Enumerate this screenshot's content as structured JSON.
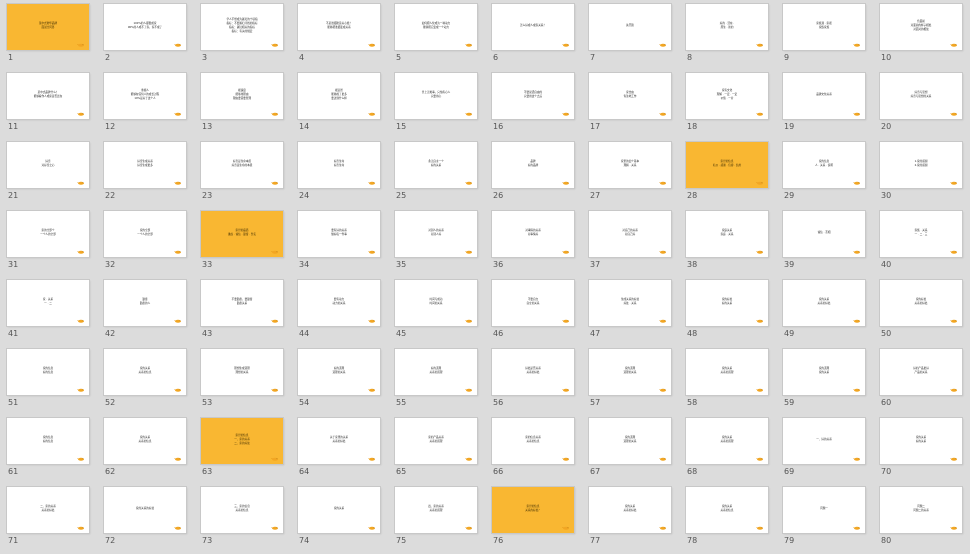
{
  "slides": [
    {
      "n": "1",
      "y": true,
      "t": "某中式奢华品牌\n面试全问答"
    },
    {
      "n": "2",
      "t": "100%的人都很成家\n90%的人成不了家，家不成了"
    },
    {
      "n": "3",
      "t": "学人不想成为寡妇的十项指\n指标：不要寡妇寻找的指标\n指标：寡妇相关的指标\n指标：有关的规定"
    },
    {
      "n": "4",
      "t": "不是谁都愿意关心谁？\n能够把谁都变成关系"
    },
    {
      "n": "5",
      "t": "如何把人化成为一种动力\n能够把它变成一个动力"
    },
    {
      "n": "6",
      "t": "怎么好成人成家关系？"
    },
    {
      "n": "7",
      "t": "先开篇"
    },
    {
      "n": "8",
      "t": "好的 · 活在 ·\n原生 · 新的"
    },
    {
      "n": "9",
      "t": "家族观 · 家观\n家族家族"
    },
    {
      "n": "10",
      "t": "色面前\n对面前的样子相处\n对面对的相处"
    },
    {
      "n": "11",
      "t": "某中式品牌什么？\n能够看作人成家是否还在"
    },
    {
      "n": "12",
      "t": "重视人\n能够在任何人的成长过程\n10%是关于这个人"
    },
    {
      "n": "13",
      "t": "视速度\n能够用理由\n理由要需要管理"
    },
    {
      "n": "14",
      "t": "视远景\n能够成了更多\n要达到什么样"
    },
    {
      "n": "15",
      "t": "世上无难事，只怕有心人\n只要用心"
    },
    {
      "n": "16",
      "t": "不要说话自由的\n只要用这个之后"
    },
    {
      "n": "17",
      "t": "家舍由\n专注地工作"
    },
    {
      "n": "18",
      "t": "家有文化\n理解 · 一定 · 一定\n价值 · 一片"
    },
    {
      "n": "19",
      "t": "品牌文化关系"
    },
    {
      "n": "20",
      "t": "好奇与思想\n好奇与思想的关系"
    },
    {
      "n": "21",
      "t": "好奇\n对好奇之心"
    },
    {
      "n": "22",
      "t": "好奇生成关系\n好奇生成更多"
    },
    {
      "n": "23",
      "t": "好奇是生命本质\n好奇是生命的本质"
    },
    {
      "n": "24",
      "t": "好奇生命\n好奇生命"
    },
    {
      "n": "25",
      "t": "永无自主一个\n好的关系"
    },
    {
      "n": "26",
      "t": "品牌\n好的品牌"
    },
    {
      "n": "27",
      "t": "家里的四个基本\n理解 · 关系"
    },
    {
      "n": "28",
      "y": true,
      "t": "家世的信息\n礼仪 · 感谢 · 包容 · 信用"
    },
    {
      "n": "29",
      "t": "家的信息\n人 · 关系 · 说明"
    },
    {
      "n": "30",
      "t": "1.家的感谢\n2.家的感谢"
    },
    {
      "n": "31",
      "t": "家的全部个\n一个人的全部"
    },
    {
      "n": "32",
      "t": "家的全部\n一个人的全部"
    },
    {
      "n": "33",
      "y": true,
      "t": "家世的品质\n谦虚 · 诚信 · 勤奋 · 务实"
    },
    {
      "n": "34",
      "t": "要有好的关系\n做好每一件事"
    },
    {
      "n": "35",
      "t": "对别人的关系\n对别人好"
    },
    {
      "n": "36",
      "t": "对事情的关系\n对事情好"
    },
    {
      "n": "37",
      "t": "对自己的关系\n对自己好"
    },
    {
      "n": "38",
      "t": "家庭关系\n家庭 · 关系"
    },
    {
      "n": "39",
      "t": "诚信 · 互相"
    },
    {
      "n": "40",
      "t": "家族 · 关系\n一 · 二 · 三"
    },
    {
      "n": "41",
      "t": "家 · 关系\n一 · 二"
    },
    {
      "n": "42",
      "t": "勤奋\n勤奋的人"
    },
    {
      "n": "43",
      "t": "不要勤奋，要勤奋\n勤奋关系"
    },
    {
      "n": "44",
      "t": "要有动力\n动力的关系"
    },
    {
      "n": "45",
      "t": "时间与成功\n时间的关系"
    },
    {
      "n": "46",
      "t": "不要自立\n自立的关系"
    },
    {
      "n": "47",
      "t": "生成关系的好处\n好处 · 关系"
    },
    {
      "n": "48",
      "t": "家的好处\n好的关系"
    },
    {
      "n": "49",
      "t": "家的关系\n关系的好处"
    },
    {
      "n": "50",
      "t": "家的好处\n关系的好处"
    },
    {
      "n": "51",
      "t": "家的信息\n好的信息"
    },
    {
      "n": "52",
      "t": "家的关系\n关系的信息"
    },
    {
      "n": "53",
      "t": "理想生成道理\n理想的关系"
    },
    {
      "n": "54",
      "t": "好的道理\n道理的关系"
    },
    {
      "n": "55",
      "t": "好的道理\n关系的道理"
    },
    {
      "n": "56",
      "t": "好处是否关系\n关系的好处"
    },
    {
      "n": "57",
      "t": "家的道理\n道理的关系"
    },
    {
      "n": "58",
      "t": "家的关系\n关系的道理"
    },
    {
      "n": "59",
      "t": "家的道理\n家的关系"
    },
    {
      "n": "60",
      "t": "好的产品更好\n产品的关系"
    },
    {
      "n": "61",
      "t": "家的信息\n好的信息"
    },
    {
      "n": "62",
      "t": "家的关系\n关系的信息"
    },
    {
      "n": "63",
      "y": true,
      "t": "家世的信息\n一、家的关系\n二、家的好处"
    },
    {
      "n": "64",
      "t": "关于家里的关系\n关系的好处"
    },
    {
      "n": "65",
      "t": "家的产品关系\n关系的道理"
    },
    {
      "n": "66",
      "t": "家的信息关系\n关系的信息"
    },
    {
      "n": "67",
      "t": "家的道理\n道理的关系"
    },
    {
      "n": "68",
      "t": "家的关系\n关系的道理"
    },
    {
      "n": "69",
      "t": "一、好的关系"
    },
    {
      "n": "70",
      "t": "家的关系\n好的关系"
    },
    {
      "n": "71",
      "t": "二、家的关系\n关系的好处"
    },
    {
      "n": "72",
      "t": "家的关系的好处"
    },
    {
      "n": "73",
      "t": "三、家的信息\n关系的信息"
    },
    {
      "n": "74",
      "t": "家的关系"
    },
    {
      "n": "75",
      "t": "四、家的关系\n关系的道理"
    },
    {
      "n": "76",
      "y": true,
      "t": "家世的信息\n关系的好处？"
    },
    {
      "n": "77",
      "t": "家的关系\n关系的好处"
    },
    {
      "n": "78",
      "t": "家的关系\n关系的信息"
    },
    {
      "n": "79",
      "t": "问题一"
    },
    {
      "n": "80",
      "t": "问题二\n问题二的关系"
    }
  ]
}
